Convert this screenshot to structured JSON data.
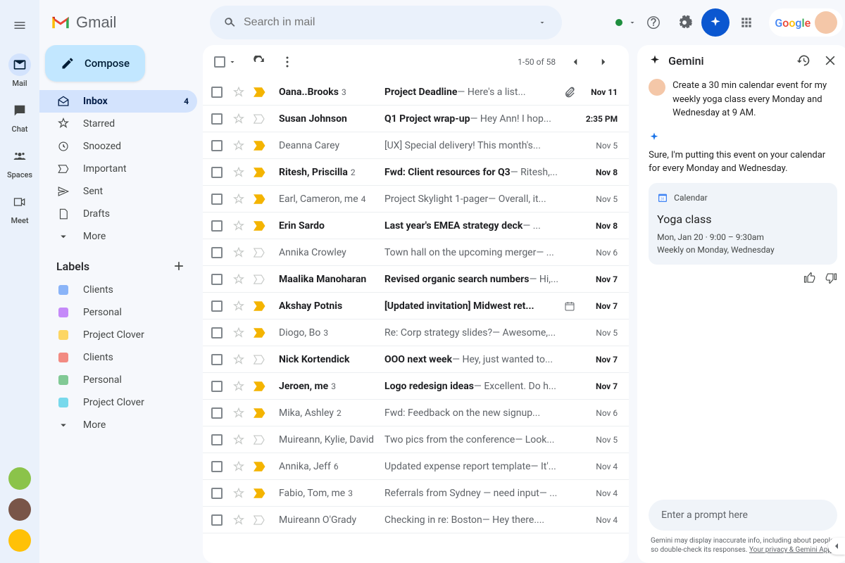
{
  "brand": "Gmail",
  "search": {
    "placeholder": "Search in mail"
  },
  "rail": {
    "items": [
      {
        "label": "Mail"
      },
      {
        "label": "Chat"
      },
      {
        "label": "Spaces"
      },
      {
        "label": "Meet"
      }
    ]
  },
  "compose_label": "Compose",
  "nav": {
    "items": [
      {
        "label": "Inbox",
        "badge": "4"
      },
      {
        "label": "Starred"
      },
      {
        "label": "Snoozed"
      },
      {
        "label": "Important"
      },
      {
        "label": "Sent"
      },
      {
        "label": "Drafts"
      },
      {
        "label": "More"
      }
    ]
  },
  "labels": {
    "header": "Labels",
    "items": [
      {
        "label": "Clients",
        "color": "#8ab4f8"
      },
      {
        "label": "Personal",
        "color": "#c58af9"
      },
      {
        "label": "Project Clover",
        "color": "#fdd663"
      },
      {
        "label": "Clients",
        "color": "#f28b82"
      },
      {
        "label": "Personal",
        "color": "#81c995"
      },
      {
        "label": "Project Clover",
        "color": "#78d9ec"
      }
    ],
    "more": "More"
  },
  "toolbar": {
    "range": "1-50 of 58"
  },
  "emails": [
    {
      "unread": true,
      "important": true,
      "sender": "Oana..Brooks",
      "count": "3",
      "subject": "Project Deadline",
      "preview": "Here's a list...",
      "attach": true,
      "date": "Nov 11"
    },
    {
      "unread": true,
      "important": false,
      "sender": "Susan Johnson",
      "count": "",
      "subject": "Q1 Project wrap-up",
      "preview": "Hey Ann! I hop...",
      "attach": false,
      "date": "2:35 PM"
    },
    {
      "unread": false,
      "important": true,
      "sender": "Deanna Carey",
      "count": "",
      "subject": "[UX] Special delivery! This month's...",
      "preview": "",
      "attach": false,
      "date": "Nov 5"
    },
    {
      "unread": true,
      "important": true,
      "sender": "Ritesh, Priscilla",
      "count": "2",
      "subject": "Fwd: Client resources for Q3",
      "preview": "Ritesh,...",
      "attach": false,
      "date": "Nov 8"
    },
    {
      "unread": false,
      "important": true,
      "sender": "Earl, Cameron, me",
      "count": "4",
      "subject": "Project Skylight 1-pager",
      "preview": "Overall, it...",
      "attach": false,
      "date": "Nov 5"
    },
    {
      "unread": true,
      "important": true,
      "sender": "Erin Sardo",
      "count": "",
      "subject": "Last year's EMEA strategy deck",
      "preview": "...",
      "attach": false,
      "date": "Nov 8"
    },
    {
      "unread": false,
      "important": false,
      "sender": "Annika Crowley",
      "count": "",
      "subject": "Town hall on the upcoming merger",
      "preview": "...",
      "attach": false,
      "date": "Nov 6"
    },
    {
      "unread": true,
      "important": false,
      "sender": "Maalika Manoharan",
      "count": "",
      "subject": "Revised organic search numbers",
      "preview": "Hi,...",
      "attach": false,
      "date": "Nov 7"
    },
    {
      "unread": true,
      "important": true,
      "sender": "Akshay Potnis",
      "count": "",
      "subject": "[Updated invitation] Midwest ret...",
      "preview": "",
      "attach": false,
      "cal": true,
      "date": "Nov 7"
    },
    {
      "unread": false,
      "important": true,
      "sender": "Diogo, Bo",
      "count": "3",
      "subject": "Re: Corp strategy slides?",
      "preview": "Awesome,...",
      "attach": false,
      "date": "Nov 5"
    },
    {
      "unread": true,
      "important": false,
      "sender": "Nick Kortendick",
      "count": "",
      "subject": "OOO next week",
      "preview": "Hey, just wanted to...",
      "attach": false,
      "date": "Nov 7"
    },
    {
      "unread": true,
      "important": true,
      "sender": "Jeroen, me",
      "count": "3",
      "subject": "Logo redesign ideas",
      "preview": "Excellent. Do h...",
      "attach": false,
      "date": "Nov 7"
    },
    {
      "unread": false,
      "important": true,
      "sender": "Mika, Ashley",
      "count": "2",
      "subject": "Fwd: Feedback on the new signup...",
      "preview": "",
      "attach": false,
      "date": "Nov 6"
    },
    {
      "unread": false,
      "important": false,
      "sender": "Muireann, Kylie, David",
      "count": "",
      "subject": "Two pics from the conference",
      "preview": "Look...",
      "attach": false,
      "date": "Nov 5"
    },
    {
      "unread": false,
      "important": true,
      "sender": "Annika, Jeff",
      "count": "6",
      "subject": "Updated expense report template",
      "preview": "It'...",
      "attach": false,
      "date": "Nov 4"
    },
    {
      "unread": false,
      "important": true,
      "sender": "Fabio, Tom, me",
      "count": "3",
      "subject": "Referrals from Sydney — need input",
      "preview": "...",
      "attach": false,
      "date": "Nov 4"
    },
    {
      "unread": false,
      "important": false,
      "sender": "Muireann O'Grady",
      "count": "",
      "subject": "Checking in re: Boston",
      "preview": "Hey there....",
      "attach": false,
      "date": "Nov 4"
    }
  ],
  "gemini": {
    "title": "Gemini",
    "user_prompt": "Create a 30 min calendar event for my weekly yoga class every Monday and Wednesday at 9 AM.",
    "assistant_reply": "Sure, I'm putting this event on your calendar for every Monday and Wednesday.",
    "card": {
      "app": "Calendar",
      "title": "Yoga class",
      "time": "Mon, Jan 20 · 9:00 – 9:30am",
      "recurrence": "Weekly on Monday, Wednesday"
    },
    "input_placeholder": "Enter a prompt here",
    "disclaimer": "Gemini may display inaccurate info, including about people, so double-check its responses.",
    "disclaimer_link": "Your privacy & Gemini Apps"
  },
  "google_word": "Google"
}
